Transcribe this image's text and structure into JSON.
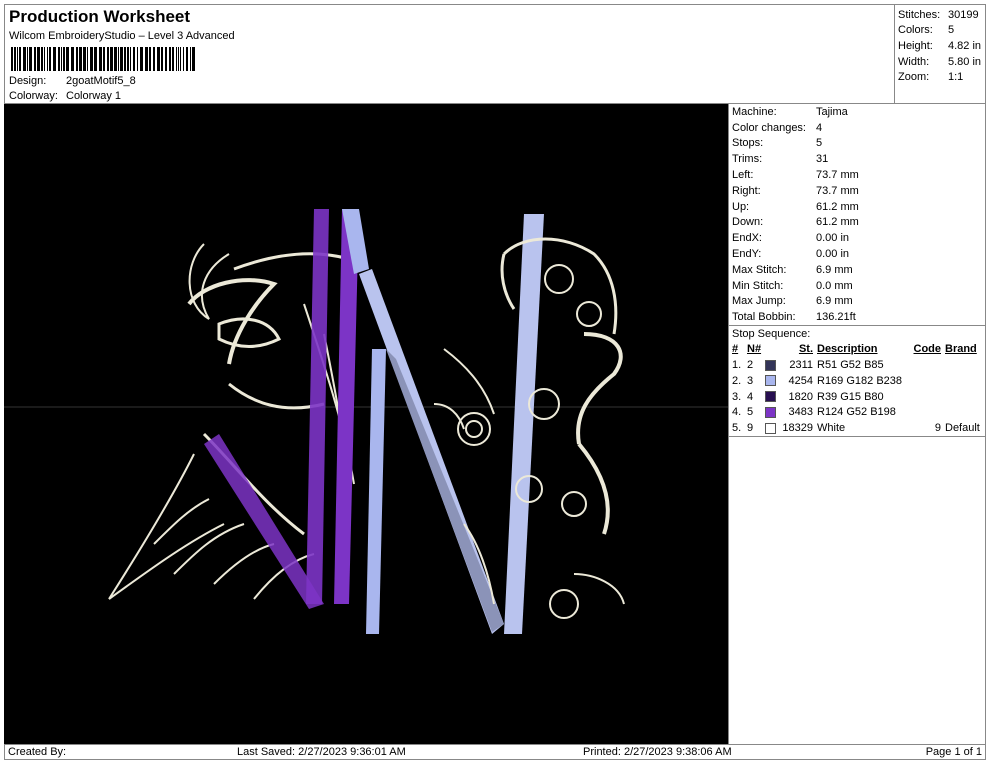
{
  "header": {
    "title": "Production Worksheet",
    "subtitle": "Wilcom EmbroideryStudio – Level 3 Advanced",
    "design_label": "Design:",
    "design_value": "2goatMotif5_8",
    "colorway_label": "Colorway:",
    "colorway_value": "Colorway 1"
  },
  "stats": [
    {
      "k": "Stitches:",
      "v": "30199"
    },
    {
      "k": "Colors:",
      "v": "5"
    },
    {
      "k": "Height:",
      "v": "4.82 in"
    },
    {
      "k": "Width:",
      "v": "5.80 in"
    },
    {
      "k": "Zoom:",
      "v": "1:1"
    }
  ],
  "machine_info": [
    {
      "k": "Machine:",
      "v": "Tajima"
    },
    {
      "k": "Color changes:",
      "v": "4"
    },
    {
      "k": "Stops:",
      "v": "5"
    },
    {
      "k": "Trims:",
      "v": "31"
    },
    {
      "k": "Left:",
      "v": "73.7 mm"
    },
    {
      "k": "Right:",
      "v": "73.7 mm"
    },
    {
      "k": "Up:",
      "v": "61.2 mm"
    },
    {
      "k": "Down:",
      "v": "61.2 mm"
    },
    {
      "k": "EndX:",
      "v": "0.00 in"
    },
    {
      "k": "EndY:",
      "v": "0.00 in"
    },
    {
      "k": "Max Stitch:",
      "v": "6.9 mm"
    },
    {
      "k": "Min Stitch:",
      "v": "0.0 mm"
    },
    {
      "k": "Max Jump:",
      "v": "6.9 mm"
    },
    {
      "k": "Total Bobbin:",
      "v": "136.21ft"
    }
  ],
  "stop_sequence": {
    "title": "Stop Sequence:",
    "headers": {
      "n": "#",
      "nn": "N#",
      "st": "St.",
      "desc": "Description",
      "code": "Code",
      "brand": "Brand"
    },
    "rows": [
      {
        "n": "1.",
        "nn": "2",
        "color": "#333458",
        "st": "2311",
        "desc": "R51 G52 B85",
        "code": "",
        "brand": ""
      },
      {
        "n": "2.",
        "nn": "3",
        "color": "#a9b6ee",
        "st": "4254",
        "desc": "R169 G182 B238",
        "code": "",
        "brand": ""
      },
      {
        "n": "3.",
        "nn": "4",
        "color": "#270f50",
        "st": "1820",
        "desc": "R39 G15 B80",
        "code": "",
        "brand": ""
      },
      {
        "n": "4.",
        "nn": "5",
        "color": "#7c34c6",
        "st": "3483",
        "desc": "R124 G52 B198",
        "code": "",
        "brand": ""
      },
      {
        "n": "5.",
        "nn": "9",
        "color": "#ffffff",
        "st": "18329",
        "desc": "White",
        "code": "9",
        "brand": "Default"
      }
    ]
  },
  "footer": {
    "created_by": "Created By:",
    "last_saved": "Last Saved: 2/27/2023 9:36:01 AM",
    "printed": "Printed: 2/27/2023 9:38:06 AM",
    "page": "Page 1 of 1"
  },
  "colors": {
    "canvas_bg": "#000000",
    "thread_white": "#ece9d8",
    "thread_purple": "#7c34c6",
    "thread_lavender": "#a9b6ee",
    "thread_slate": "#333458"
  }
}
